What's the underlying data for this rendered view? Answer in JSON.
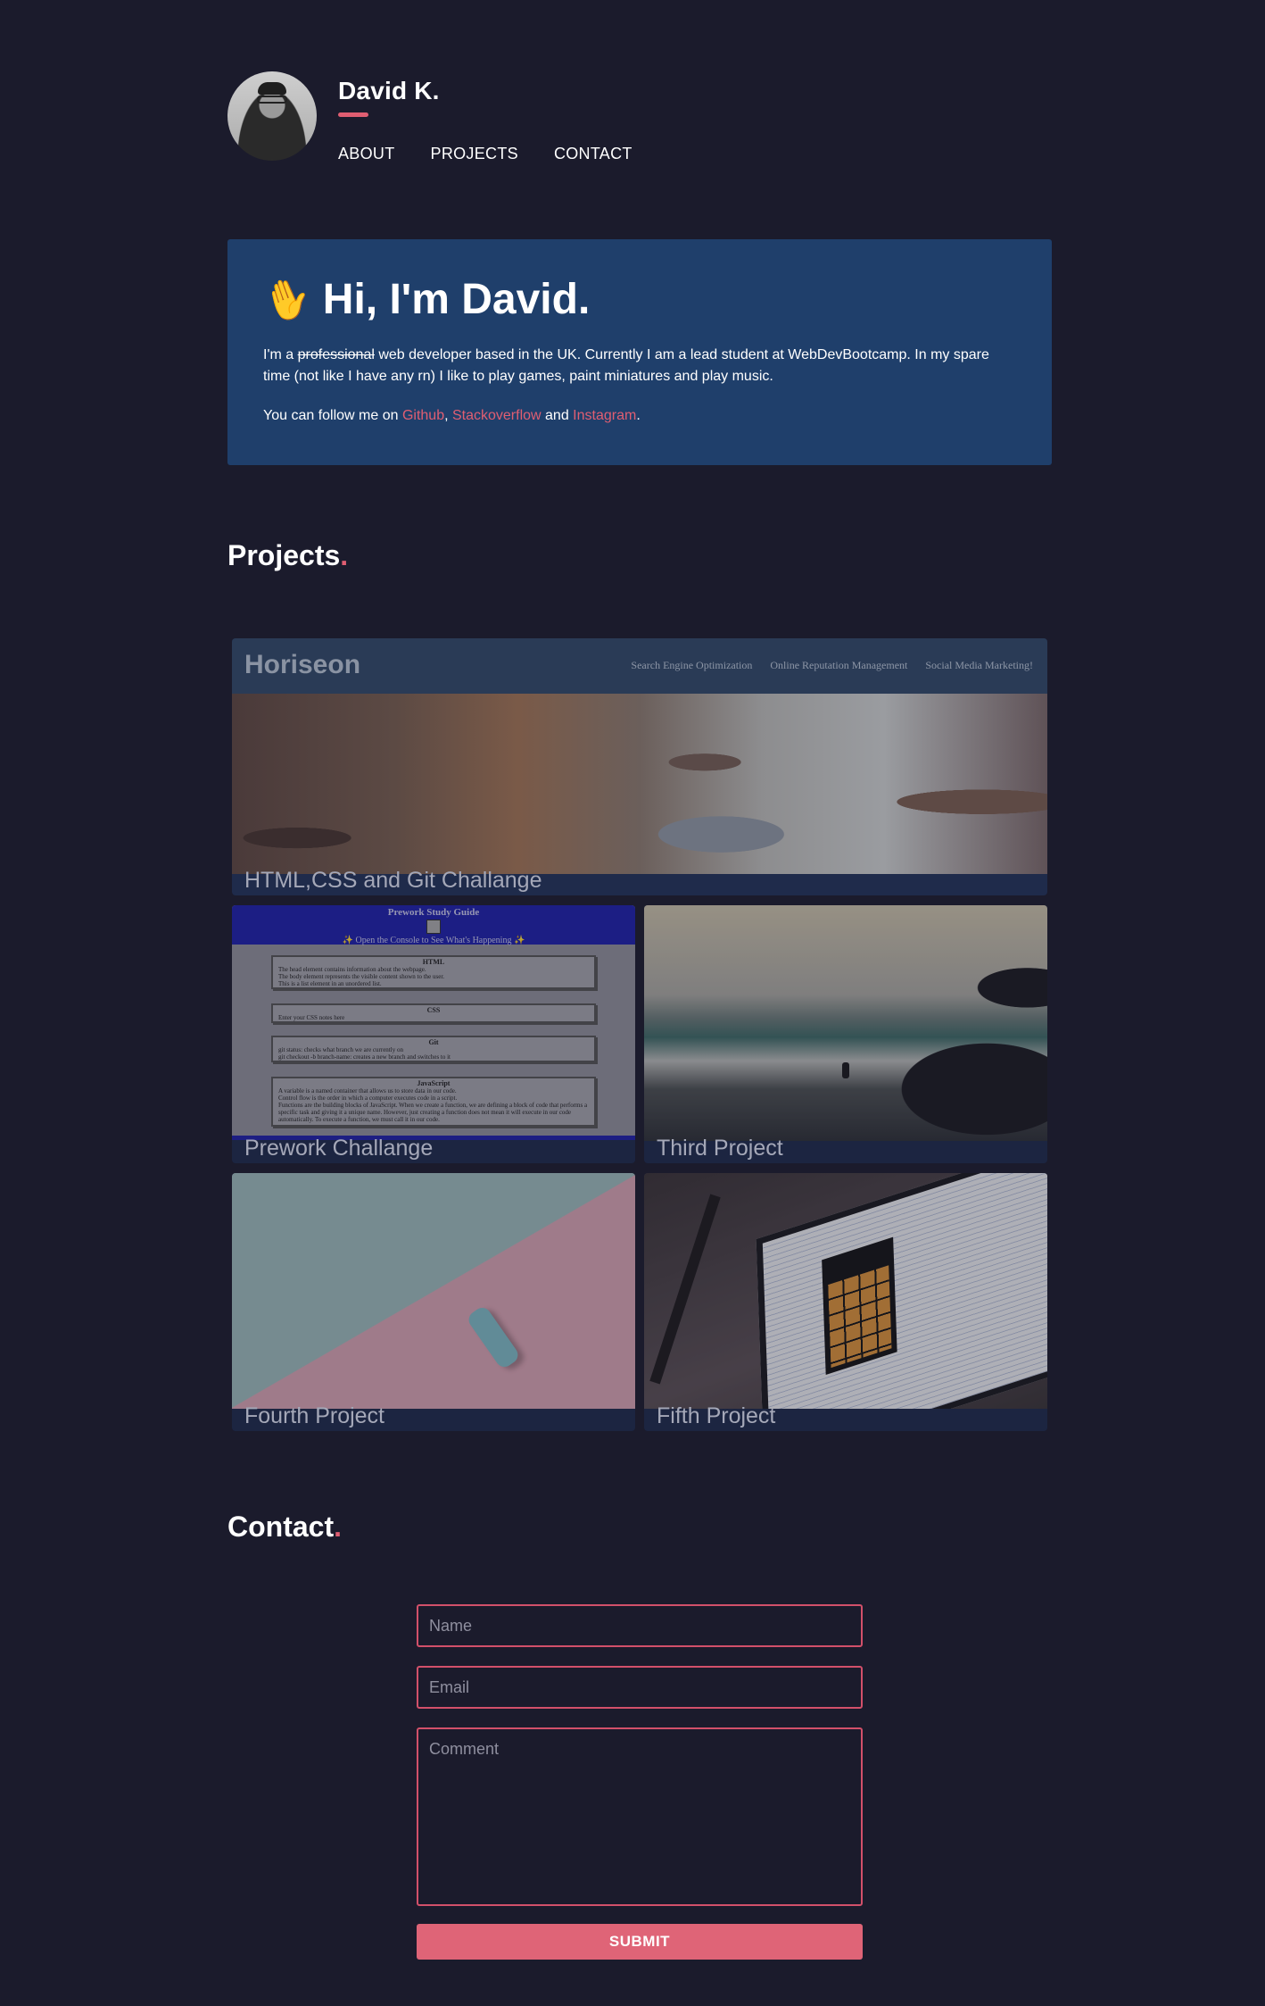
{
  "header": {
    "name": "David K.",
    "nav": [
      "ABOUT",
      "PROJECTS",
      "CONTACT"
    ]
  },
  "hero": {
    "greeting": "Hi, I'm David.",
    "bio_prefix": "I'm a ",
    "bio_strike": "professional",
    "bio_rest": " web developer based in the UK. Currently I am a lead student at WebDevBootcamp. In my spare time (not like I have any rn) I like to play games, paint miniatures and play music.",
    "follow_prefix": "You can follow me on ",
    "links": [
      "Github",
      "Stackoverflow",
      "Instagram"
    ],
    "sep_comma": ", ",
    "sep_and": " and ",
    "follow_suffix": "."
  },
  "projects": {
    "title": "Projects",
    "dot": ".",
    "items": [
      {
        "label": "HTML,CSS and Git Challange"
      },
      {
        "label": "Prework Challange"
      },
      {
        "label": "Third Project"
      },
      {
        "label": "Fourth Project"
      },
      {
        "label": "Fifth Project"
      }
    ],
    "horiseon": {
      "logo": "Horiseon",
      "links": [
        "Search Engine Optimization",
        "Online Reputation Management",
        "Social Media Marketing!"
      ]
    },
    "prework": {
      "title": "Prework Study Guide",
      "subtitle": "✨ Open the Console to See What's Happening ✨",
      "boxes": [
        {
          "title": "HTML",
          "lines": [
            "The head element contains information about the webpage.",
            "The body element represents the visible content shown to the user.",
            "This is a list element in an unordered list."
          ]
        },
        {
          "title": "CSS",
          "lines": [
            "Enter your CSS notes here"
          ]
        },
        {
          "title": "Git",
          "lines": [
            "git status: checks what branch we are currently on",
            "git checkout -b branch-name: creates a new branch and switches to it"
          ]
        },
        {
          "title": "JavaScript",
          "lines": [
            "A variable is a named container that allows us to store data in our code.",
            "Control flow is the order in which a computer executes code in a script.",
            "Functions are the building blocks of JavaScript. When we create a function, we are defining a block of code that performs a specific task and giving it a unique name. However, just creating a function does not mean it will execute in our code automatically. To execute a function, we must call it in our code."
          ]
        }
      ]
    }
  },
  "contact": {
    "title": "Contact",
    "dot": ".",
    "name_placeholder": "Name",
    "email_placeholder": "Email",
    "comment_placeholder": "Comment",
    "submit_label": "SUBMIT"
  },
  "colors": {
    "background": "#1b1b2c",
    "hero": "#1f3f6b",
    "accent": "#e05e72"
  }
}
